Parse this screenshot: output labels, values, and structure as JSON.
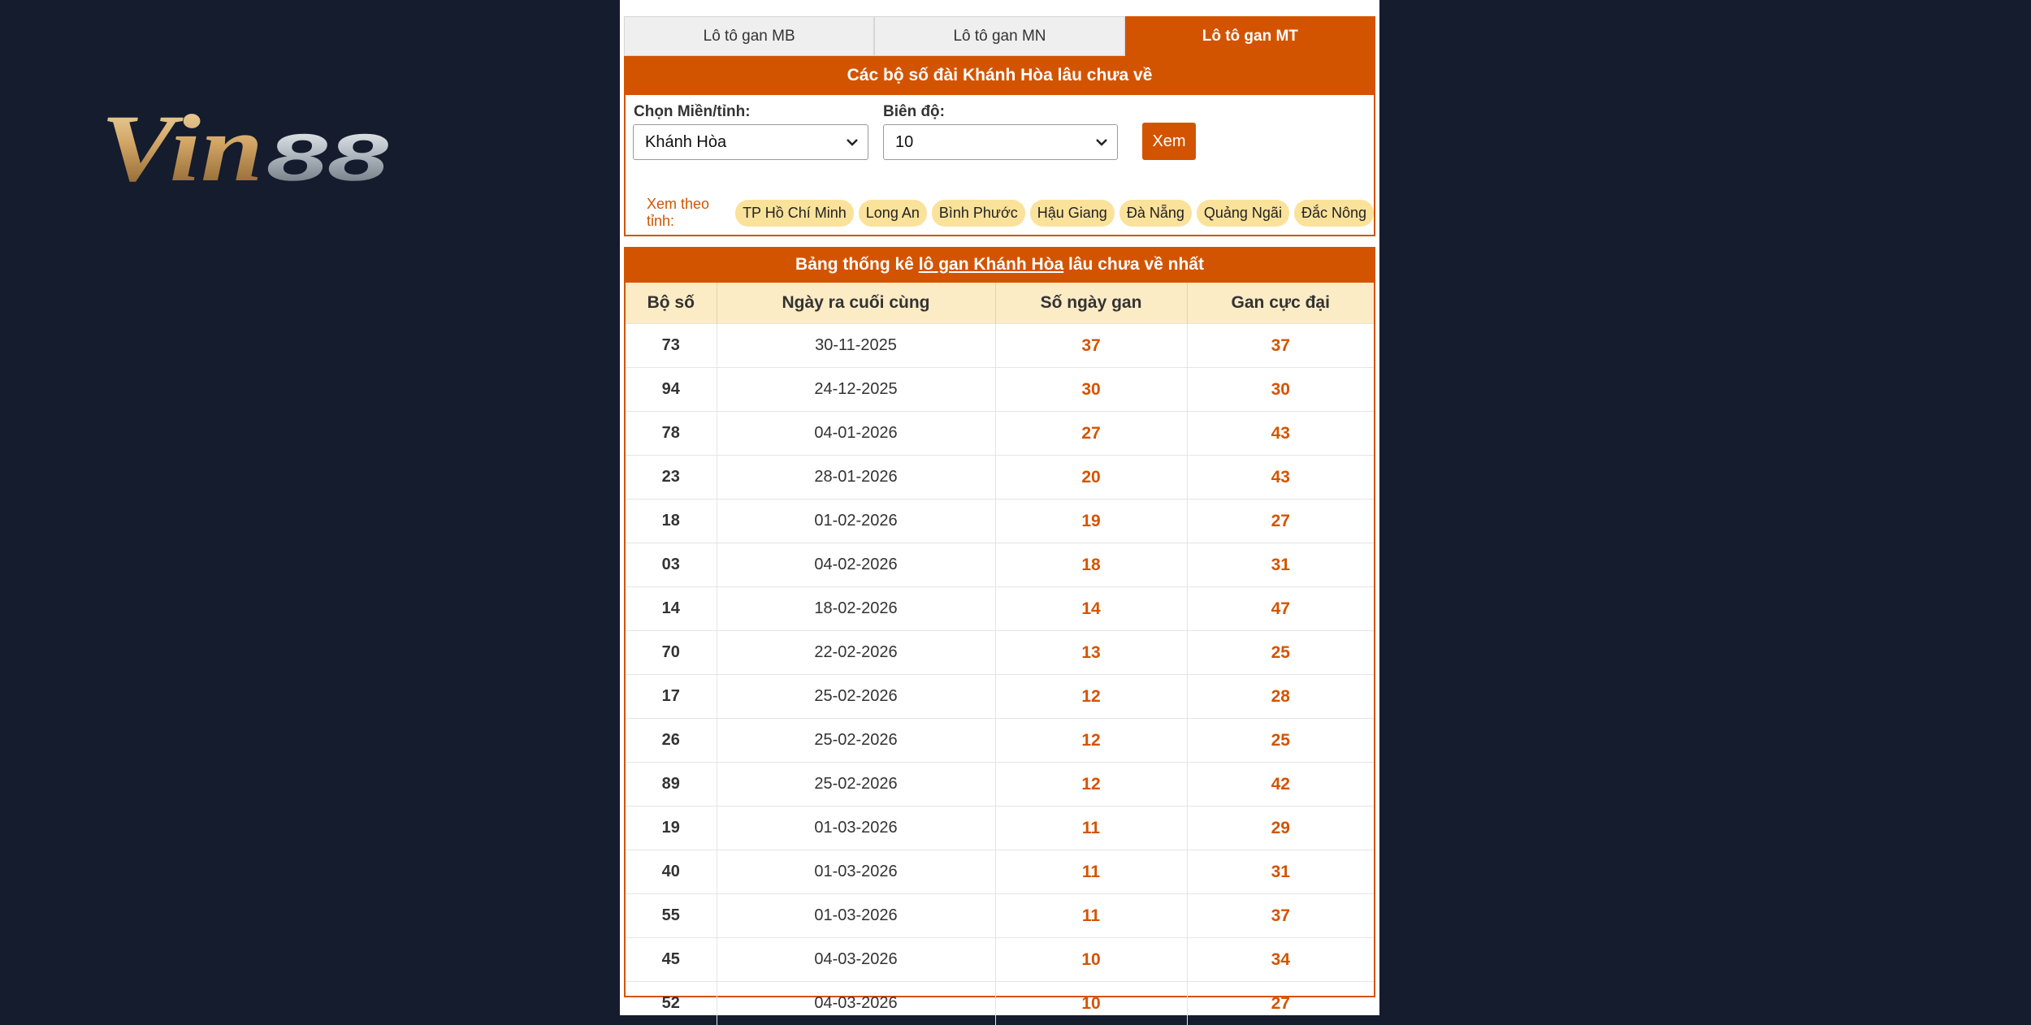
{
  "brand": {
    "logo_text": "Vin88",
    "logo_part1": "Vin",
    "logo_part2": "88"
  },
  "tabs": [
    {
      "label": "Lô tô gan MB",
      "active": false
    },
    {
      "label": "Lô tô gan MN",
      "active": false
    },
    {
      "label": "Lô tô gan MT",
      "active": true
    }
  ],
  "form": {
    "title": "Các bộ số đài Khánh Hòa lâu chưa về",
    "region_label": "Chọn Miền/tỉnh:",
    "region_value": "Khánh Hòa",
    "range_label": "Biên độ:",
    "range_value": "10",
    "submit_label": "Xem",
    "filter_label": "Xem theo tỉnh:",
    "provinces": [
      "TP Hồ Chí Minh",
      "Long An",
      "Bình Phước",
      "Hậu Giang",
      "Đà Nẵng",
      "Quảng Ngãi",
      "Đắc Nông"
    ]
  },
  "stats": {
    "title_prefix": "Bảng thống kê ",
    "title_link": "lô gan Khánh Hòa",
    "title_suffix": " lâu chưa về nhất",
    "columns": [
      "Bộ số",
      "Ngày ra cuối cùng",
      "Số ngày gan",
      "Gan cực đại"
    ],
    "rows": [
      [
        "73",
        "30-11-2025",
        "37",
        "37"
      ],
      [
        "94",
        "24-12-2025",
        "30",
        "30"
      ],
      [
        "78",
        "04-01-2026",
        "27",
        "43"
      ],
      [
        "23",
        "28-01-2026",
        "20",
        "43"
      ],
      [
        "18",
        "01-02-2026",
        "19",
        "27"
      ],
      [
        "03",
        "04-02-2026",
        "18",
        "31"
      ],
      [
        "14",
        "18-02-2026",
        "14",
        "47"
      ],
      [
        "70",
        "22-02-2026",
        "13",
        "25"
      ],
      [
        "17",
        "25-02-2026",
        "12",
        "28"
      ],
      [
        "26",
        "25-02-2026",
        "12",
        "25"
      ],
      [
        "89",
        "25-02-2026",
        "12",
        "42"
      ],
      [
        "19",
        "01-03-2026",
        "11",
        "29"
      ],
      [
        "40",
        "01-03-2026",
        "11",
        "31"
      ],
      [
        "55",
        "01-03-2026",
        "11",
        "37"
      ],
      [
        "45",
        "04-03-2026",
        "10",
        "34"
      ],
      [
        "52",
        "04-03-2026",
        "10",
        "27"
      ]
    ]
  },
  "colors": {
    "accent": "#d35400",
    "background": "#141c2e",
    "chip": "#fbe29a",
    "table_header": "#fbecc6"
  }
}
